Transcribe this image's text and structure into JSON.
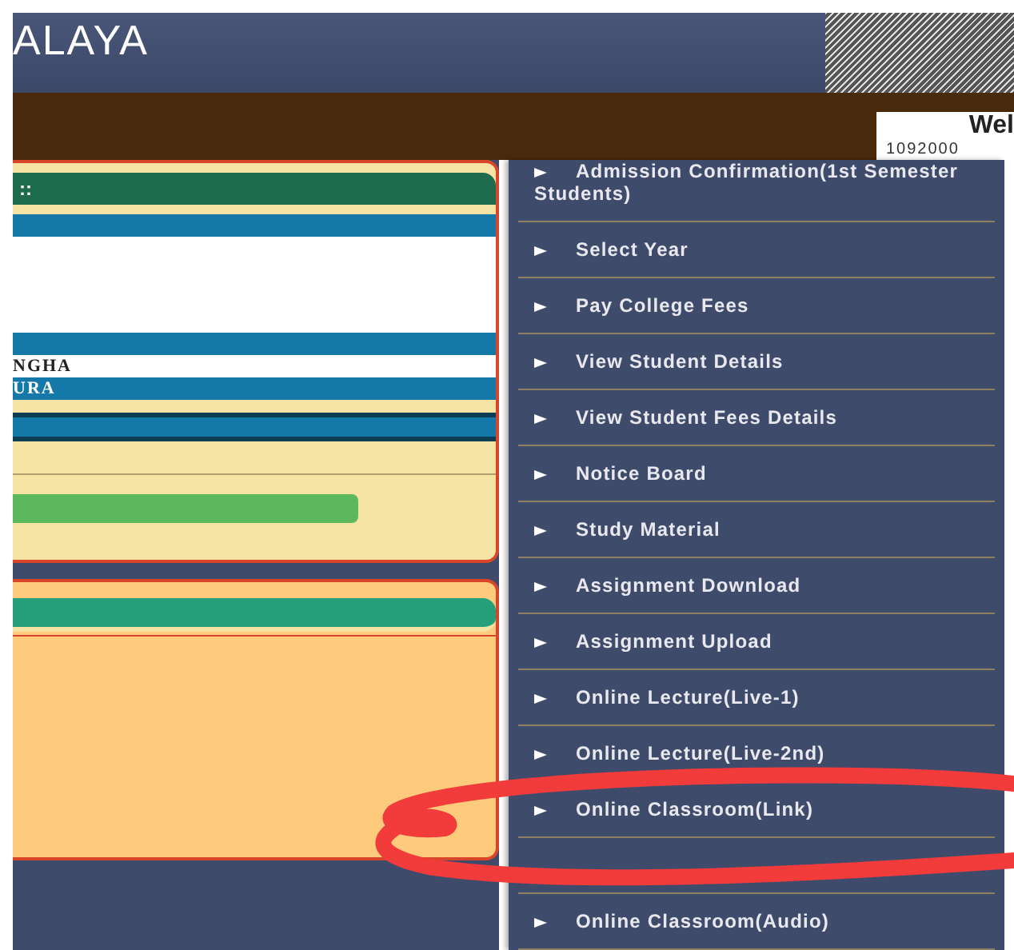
{
  "header": {
    "title": "ALAYA"
  },
  "welcome_box": {
    "heading": "Wel",
    "id": "1092000"
  },
  "panel": {
    "header_text": "::",
    "rows": [
      "NGHA",
      "URA"
    ]
  },
  "menu": {
    "items": [
      {
        "kind": "link",
        "label": "Admission Confirmation(1st Semester Students)"
      },
      {
        "kind": "link",
        "label": "Select Year"
      },
      {
        "kind": "link",
        "label": "Pay College Fees"
      },
      {
        "kind": "link",
        "label": "View Student Details"
      },
      {
        "kind": "link",
        "label": "View Student Fees Details"
      },
      {
        "kind": "link",
        "label": "Notice Board"
      },
      {
        "kind": "link",
        "label": "Study Material"
      },
      {
        "kind": "link",
        "label": "Assignment Download"
      },
      {
        "kind": "link",
        "label": "Assignment Upload"
      },
      {
        "kind": "link",
        "label": "Online Lecture(Live-1)"
      },
      {
        "kind": "link",
        "label": "Online Lecture(Live-2nd)"
      },
      {
        "kind": "link",
        "label": "Online Classroom(Link)"
      },
      {
        "kind": "obscured"
      },
      {
        "kind": "link",
        "label": "Online Classroom(Audio)"
      }
    ]
  }
}
